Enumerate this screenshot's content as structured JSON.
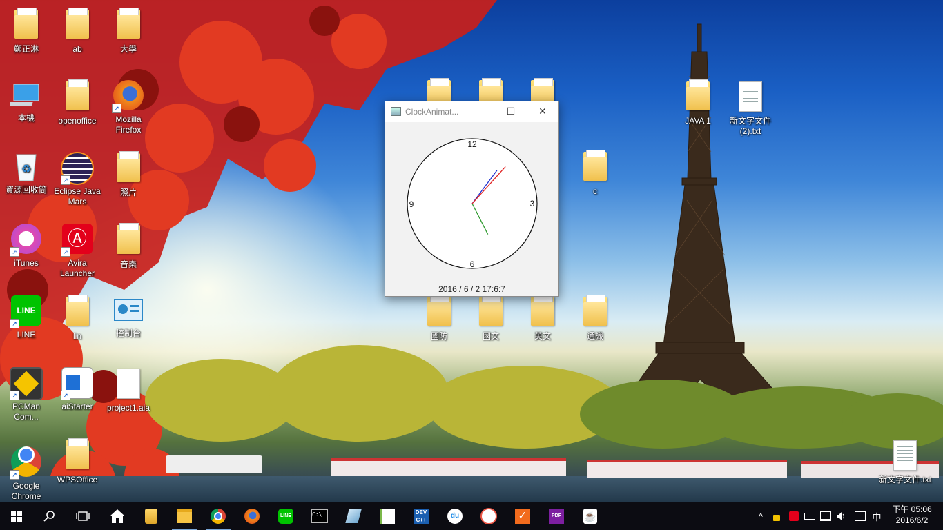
{
  "desktop": {
    "icons": [
      {
        "label": "鄭正淋"
      },
      {
        "label": "ab"
      },
      {
        "label": "大學"
      },
      {
        "label": "本機"
      },
      {
        "label": "openoffice"
      },
      {
        "label": "Mozilla Firefox"
      },
      {
        "label": "資源回收筒"
      },
      {
        "label": "Eclipse Java Mars"
      },
      {
        "label": "照片"
      },
      {
        "label": "iTunes"
      },
      {
        "label": "Avira Launcher"
      },
      {
        "label": "音樂"
      },
      {
        "label": "LINE"
      },
      {
        "label": "lin"
      },
      {
        "label": "控制台"
      },
      {
        "label": "PCMan Com..."
      },
      {
        "label": "aiStarter"
      },
      {
        "label": "project1.aia"
      },
      {
        "label": "Google Chrome"
      },
      {
        "label": "WPSOffice"
      },
      {
        "label": "c"
      },
      {
        "label": "國防"
      },
      {
        "label": "國文"
      },
      {
        "label": "英文"
      },
      {
        "label": "通識"
      },
      {
        "label": "JAVA 1"
      },
      {
        "label": "新文字文件 (2).txt"
      },
      {
        "label": "新文字文件.txt"
      }
    ]
  },
  "window": {
    "title": "ClockAnimat...",
    "minimize": "—",
    "maximize": "☐",
    "close": "✕",
    "clock": {
      "numerals": {
        "n12": "12",
        "n3": "3",
        "n6": "6",
        "n9": "9"
      },
      "time": {
        "hour": 17,
        "minute": 6,
        "second": 7
      },
      "hand_colors": {
        "hour": "#2e9a2e",
        "minute": "#2030d0",
        "second": "#e02020"
      },
      "datetime_text": "2016 / 6 / 2  17:6:7"
    }
  },
  "taskbar": {
    "start_icon": "windows-logo-icon",
    "search_icon": "search-icon",
    "taskview_icon": "task-view-icon",
    "apps": [
      "home-icon",
      "notes-icon",
      "file-explorer-icon",
      "chrome-icon",
      "firefox-icon",
      "line-icon",
      "cmd-icon",
      "app-icon",
      "notepad-plus-icon",
      "devcpp-icon",
      "baidu-icon",
      "snipping-icon",
      "todo-icon",
      "pdf-icon",
      "java-icon"
    ],
    "tray": {
      "chevron": "^",
      "ime": "中",
      "time": "下午 05:06",
      "date": "2016/6/2"
    }
  },
  "colors": {
    "accent": "#7aa7d8",
    "taskbar": "#0c0c12"
  }
}
